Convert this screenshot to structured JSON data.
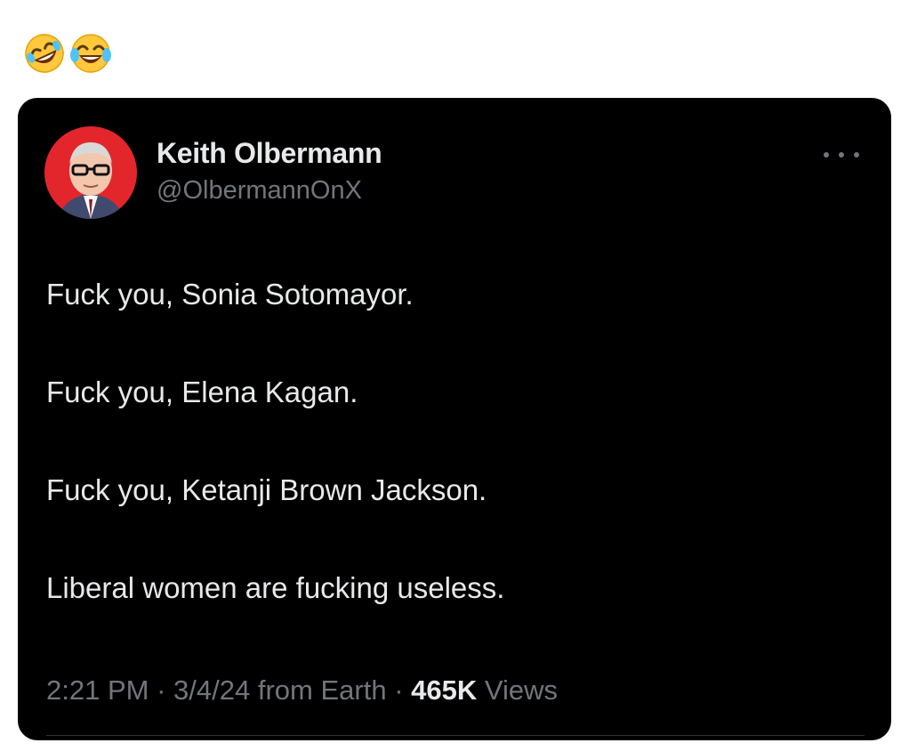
{
  "emojis": [
    "rolling-on-floor-laughing",
    "face-with-tears-of-joy"
  ],
  "tweet": {
    "author_name": "Keith Olbermann",
    "author_handle": "@OlbermannOnX",
    "lines": [
      "Fuck you, Sonia Sotomayor.",
      "Fuck you, Elena Kagan.",
      "Fuck you, Ketanji Brown Jackson.",
      "Liberal women are fucking useless."
    ],
    "time": "2:21 PM",
    "date": "3/4/24",
    "source": "from Earth",
    "separator": "·",
    "views_count": "465K",
    "views_label": "Views"
  },
  "colors": {
    "card_bg": "#000000",
    "text_primary": "#e7e9ea",
    "text_secondary": "#71767b",
    "avatar_ring": "#e3262b"
  }
}
